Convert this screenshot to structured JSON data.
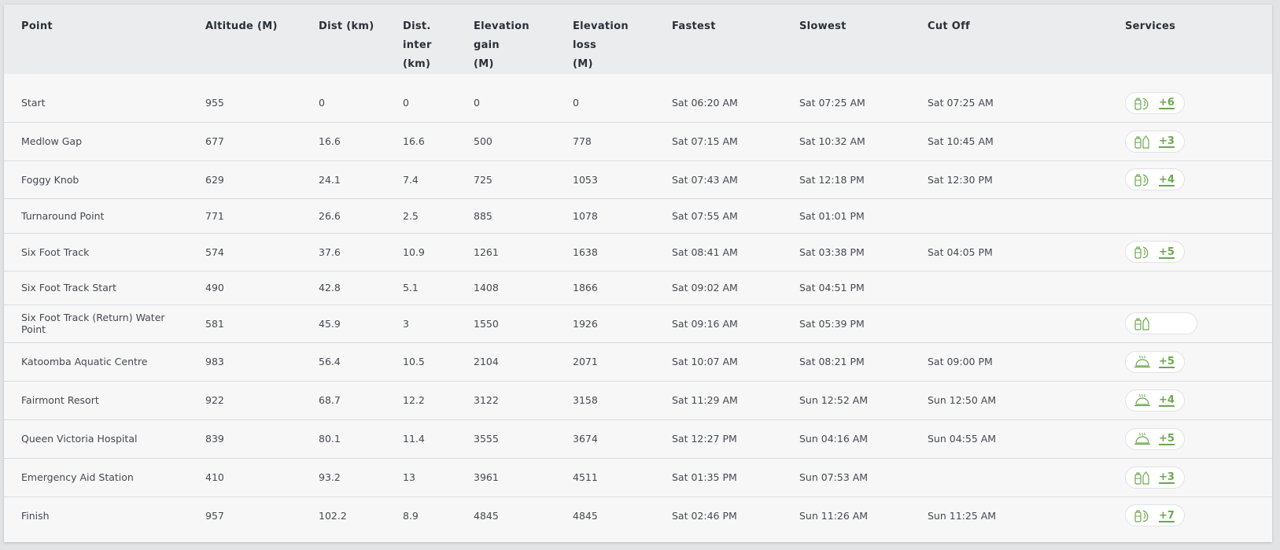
{
  "colors": {
    "accent": "#6aa84f",
    "header_bg": "#ebecee",
    "row_bg": "#f7f7f7"
  },
  "columns": [
    "Point",
    "Altitude (M)",
    "Dist (km)",
    "Dist. inter (km)",
    "Elevation gain (M)",
    "Elevation loss (M)",
    "Fastest",
    "Slowest",
    "Cut Off",
    "Services"
  ],
  "headers": {
    "point": "Point",
    "altitude": "Altitude (M)",
    "dist": "Dist (km)",
    "inter_1": "Dist. inter",
    "inter_2": "(km)",
    "gain_1": "Elevation gain",
    "gain_2": "(M)",
    "loss_1": "Elevation loss",
    "loss_2": "(M)",
    "fastest": "Fastest",
    "slowest": "Slowest",
    "cutoff": "Cut Off",
    "services": "Services"
  },
  "rows": [
    {
      "point": "Start",
      "altitude": "955",
      "dist": "0",
      "inter": "0",
      "gain": "0",
      "loss": "0",
      "fastest": "Sat 06:20 AM",
      "slowest": "Sat 07:25 AM",
      "cutoff": "Sat 07:25 AM",
      "service_icon": "water-food-icon",
      "service_more": "+6"
    },
    {
      "point": "Medlow Gap",
      "altitude": "677",
      "dist": "16.6",
      "inter": "16.6",
      "gain": "500",
      "loss": "778",
      "fastest": "Sat 07:15 AM",
      "slowest": "Sat 10:32 AM",
      "cutoff": "Sat 10:45 AM",
      "service_icon": "water-bottles-icon",
      "service_more": "+3"
    },
    {
      "point": "Foggy Knob",
      "altitude": "629",
      "dist": "24.1",
      "inter": "7.4",
      "gain": "725",
      "loss": "1053",
      "fastest": "Sat 07:43 AM",
      "slowest": "Sat 12:18 PM",
      "cutoff": "Sat 12:30 PM",
      "service_icon": "water-food-icon",
      "service_more": "+4"
    },
    {
      "point": "Turnaround Point",
      "altitude": "771",
      "dist": "26.6",
      "inter": "2.5",
      "gain": "885",
      "loss": "1078",
      "fastest": "Sat 07:55 AM",
      "slowest": "Sat 01:01 PM",
      "cutoff": "",
      "service_icon": "",
      "service_more": ""
    },
    {
      "point": "Six Foot Track",
      "altitude": "574",
      "dist": "37.6",
      "inter": "10.9",
      "gain": "1261",
      "loss": "1638",
      "fastest": "Sat 08:41 AM",
      "slowest": "Sat 03:38 PM",
      "cutoff": "Sat 04:05 PM",
      "service_icon": "water-food-icon",
      "service_more": "+5"
    },
    {
      "point": "Six Foot Track Start",
      "altitude": "490",
      "dist": "42.8",
      "inter": "5.1",
      "gain": "1408",
      "loss": "1866",
      "fastest": "Sat 09:02 AM",
      "slowest": "Sat 04:51 PM",
      "cutoff": "",
      "service_icon": "",
      "service_more": ""
    },
    {
      "point": "Six Foot Track (Return) Water Point",
      "altitude": "581",
      "dist": "45.9",
      "inter": "3",
      "gain": "1550",
      "loss": "1926",
      "fastest": "Sat 09:16 AM",
      "slowest": "Sat 05:39 PM",
      "cutoff": "",
      "service_icon": "water-bottles-icon",
      "service_more": ""
    },
    {
      "point": "Katoomba Aquatic Centre",
      "altitude": "983",
      "dist": "56.4",
      "inter": "10.5",
      "gain": "2104",
      "loss": "2071",
      "fastest": "Sat 10:07 AM",
      "slowest": "Sat 08:21 PM",
      "cutoff": "Sat 09:00 PM",
      "service_icon": "hot-meal-icon",
      "service_more": "+5"
    },
    {
      "point": "Fairmont Resort",
      "altitude": "922",
      "dist": "68.7",
      "inter": "12.2",
      "gain": "3122",
      "loss": "3158",
      "fastest": "Sat 11:29 AM",
      "slowest": "Sun 12:52 AM",
      "cutoff": "Sun 12:50 AM",
      "service_icon": "hot-meal-icon",
      "service_more": "+4"
    },
    {
      "point": "Queen Victoria Hospital",
      "altitude": "839",
      "dist": "80.1",
      "inter": "11.4",
      "gain": "3555",
      "loss": "3674",
      "fastest": "Sat 12:27 PM",
      "slowest": "Sun 04:16 AM",
      "cutoff": "Sun 04:55 AM",
      "service_icon": "hot-meal-icon",
      "service_more": "+5"
    },
    {
      "point": "Emergency Aid Station",
      "altitude": "410",
      "dist": "93.2",
      "inter": "13",
      "gain": "3961",
      "loss": "4511",
      "fastest": "Sat 01:35 PM",
      "slowest": "Sun 07:53 AM",
      "cutoff": "",
      "service_icon": "water-bottles-icon",
      "service_more": "+3"
    },
    {
      "point": "Finish",
      "altitude": "957",
      "dist": "102.2",
      "inter": "8.9",
      "gain": "4845",
      "loss": "4845",
      "fastest": "Sat 02:46 PM",
      "slowest": "Sun 11:26 AM",
      "cutoff": "Sun 11:25 AM",
      "service_icon": "water-food-icon",
      "service_more": "+7"
    }
  ]
}
